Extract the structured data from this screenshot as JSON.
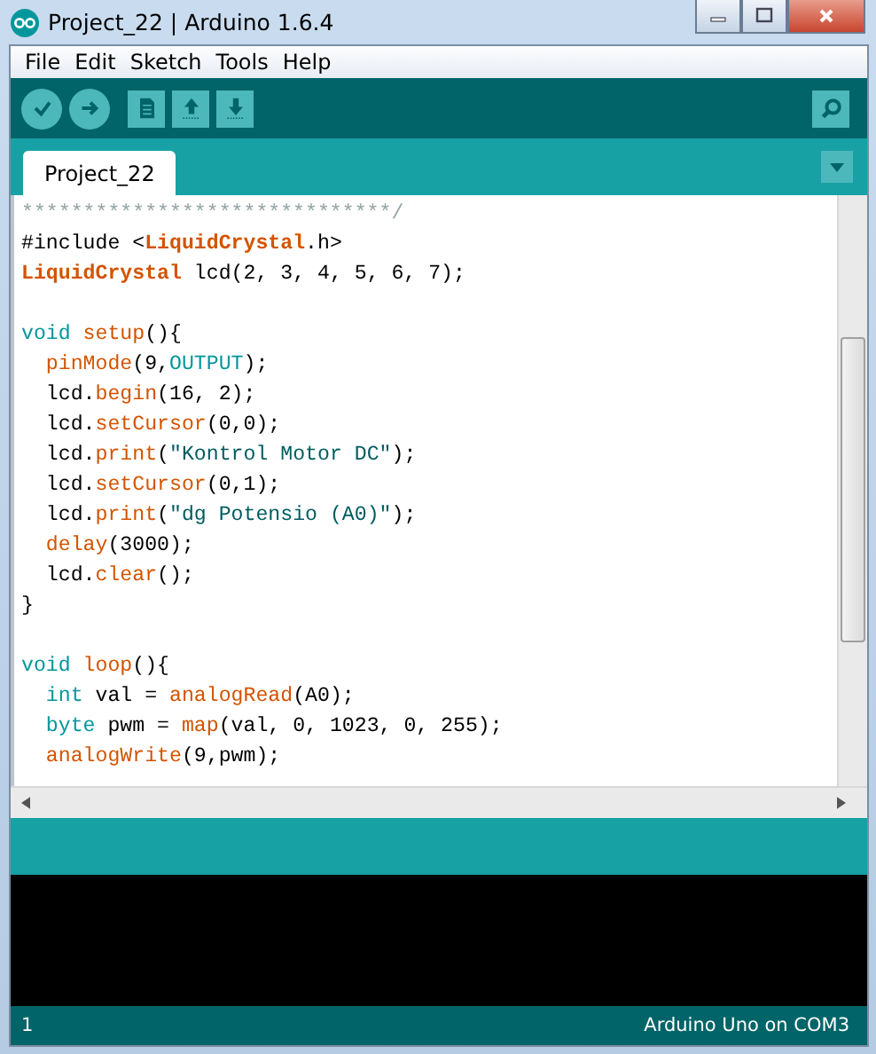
{
  "window": {
    "title": "Project_22 | Arduino 1.6.4"
  },
  "menu": [
    "File",
    "Edit",
    "Sketch",
    "Tools",
    "Help"
  ],
  "tabs": [
    {
      "label": "Project_22",
      "selected": true
    }
  ],
  "code_blocks": [
    [
      [
        {
          "kind": "comment",
          "text": "******************************/"
        }
      ],
      [
        {
          "kind": "plain",
          "text": "#include <"
        },
        {
          "kind": "class",
          "text": "LiquidCrystal"
        },
        {
          "kind": "plain",
          "text": ".h>"
        }
      ],
      [
        {
          "kind": "class",
          "text": "LiquidCrystal"
        },
        {
          "kind": "plain",
          "text": " lcd(2, 3, 4, 5, 6, 7);"
        }
      ]
    ],
    [
      [
        {
          "kind": "type",
          "text": "void "
        },
        {
          "kind": "func",
          "text": "setup"
        },
        {
          "kind": "plain",
          "text": "(){"
        }
      ],
      [
        {
          "kind": "func",
          "text": "  pinMode"
        },
        {
          "kind": "plain",
          "text": "(9,"
        },
        {
          "kind": "const",
          "text": "OUTPUT"
        },
        {
          "kind": "plain",
          "text": ");"
        }
      ],
      [
        {
          "kind": "plain",
          "text": "  lcd."
        },
        {
          "kind": "func",
          "text": "begin"
        },
        {
          "kind": "plain",
          "text": "(16, 2);"
        }
      ],
      [
        {
          "kind": "plain",
          "text": "  lcd."
        },
        {
          "kind": "func",
          "text": "setCursor"
        },
        {
          "kind": "plain",
          "text": "(0,0);"
        }
      ],
      [
        {
          "kind": "plain",
          "text": "  lcd."
        },
        {
          "kind": "func",
          "text": "print"
        },
        {
          "kind": "plain",
          "text": "("
        },
        {
          "kind": "string",
          "text": "\"Kontrol Motor DC\""
        },
        {
          "kind": "plain",
          "text": ");"
        }
      ],
      [
        {
          "kind": "plain",
          "text": "  lcd."
        },
        {
          "kind": "func",
          "text": "setCursor"
        },
        {
          "kind": "plain",
          "text": "(0,1);"
        }
      ],
      [
        {
          "kind": "plain",
          "text": "  lcd."
        },
        {
          "kind": "func",
          "text": "print"
        },
        {
          "kind": "plain",
          "text": "("
        },
        {
          "kind": "string",
          "text": "\"dg Potensio (A0)\""
        },
        {
          "kind": "plain",
          "text": ");"
        }
      ],
      [
        {
          "kind": "func",
          "text": "  delay"
        },
        {
          "kind": "plain",
          "text": "(3000);"
        }
      ],
      [
        {
          "kind": "plain",
          "text": "  lcd."
        },
        {
          "kind": "func",
          "text": "clear"
        },
        {
          "kind": "plain",
          "text": "();"
        }
      ],
      [
        {
          "kind": "plain",
          "text": "}"
        }
      ]
    ],
    [
      [
        {
          "kind": "type",
          "text": "void "
        },
        {
          "kind": "func",
          "text": "loop"
        },
        {
          "kind": "plain",
          "text": "(){"
        }
      ],
      [
        {
          "kind": "type",
          "text": "  int"
        },
        {
          "kind": "plain",
          "text": " val = "
        },
        {
          "kind": "func",
          "text": "analogRead"
        },
        {
          "kind": "plain",
          "text": "(A0);"
        }
      ],
      [
        {
          "kind": "type",
          "text": "  byte"
        },
        {
          "kind": "plain",
          "text": " pwm = "
        },
        {
          "kind": "func",
          "text": "map"
        },
        {
          "kind": "plain",
          "text": "(val, 0, 1023, 0, 255);"
        }
      ],
      [
        {
          "kind": "func",
          "text": "  analogWrite"
        },
        {
          "kind": "plain",
          "text": "(9,pwm);"
        }
      ]
    ]
  ],
  "status_bar": {
    "line": "1",
    "board": "Arduino Uno on COM3"
  }
}
